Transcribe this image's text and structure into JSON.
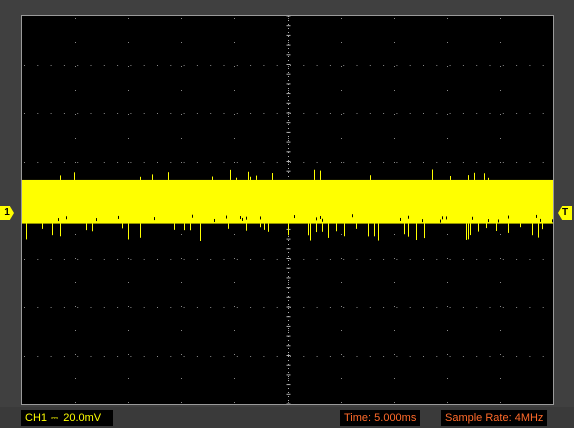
{
  "channel": {
    "label": "CH1",
    "coupling_icon": "dc-coupling-icon",
    "coupling_glyph": "⎓",
    "volts_per_div": "20.0mV",
    "marker_text": "1",
    "color": "#ffff00"
  },
  "trigger": {
    "marker_text": "T",
    "color": "#ffff00"
  },
  "timebase": {
    "time_text": "Time: 5.000ms",
    "sample_rate_text": "Sample Rate: 4MHz",
    "color": "#ff6a2a"
  },
  "chart_data": {
    "type": "line",
    "title": "",
    "xlabel": "",
    "ylabel": "",
    "grid": true,
    "x_divisions": 10,
    "y_divisions": 8,
    "ylim": [
      -4,
      4
    ],
    "series": [
      {
        "trace_center_div": 0.17,
        "trace_band_half_width_div": 0.45,
        "spike_max_div": 0.3
      }
    ]
  }
}
